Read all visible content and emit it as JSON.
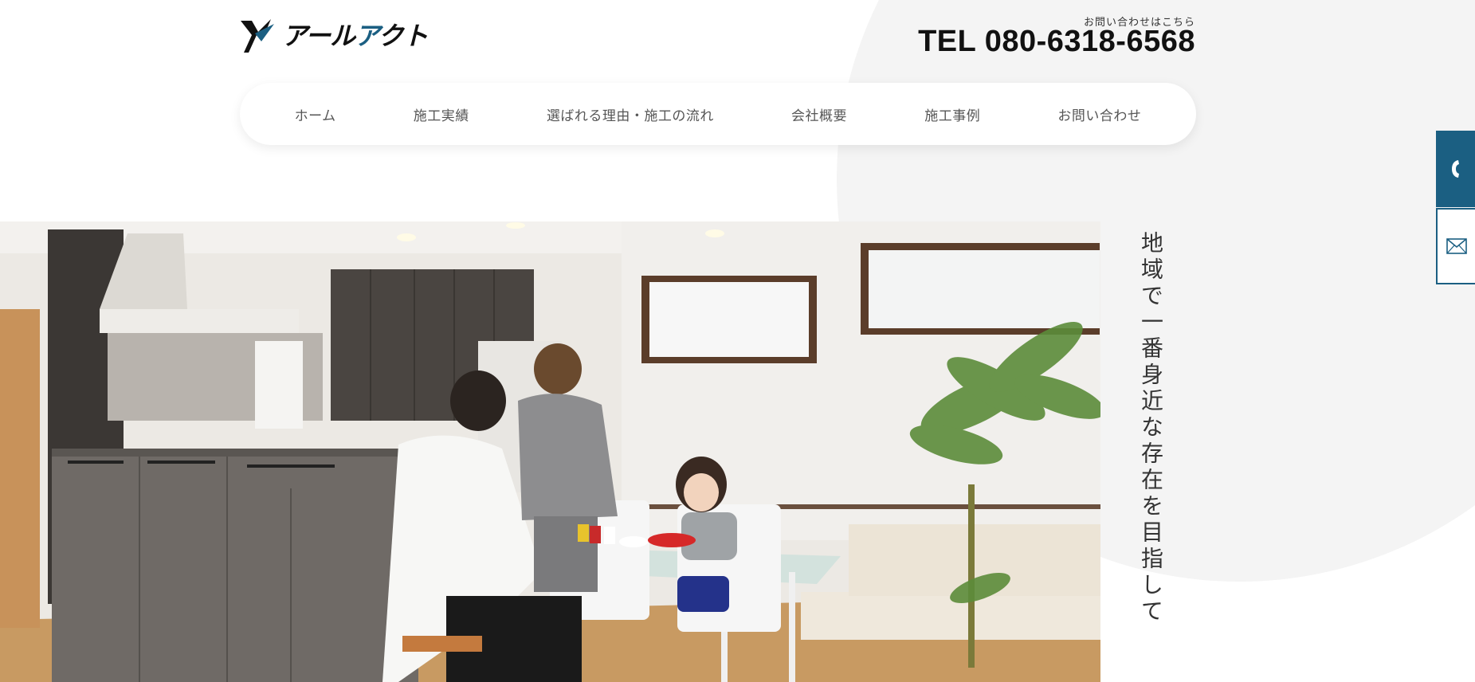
{
  "header": {
    "logo_text_black_1": "アール",
    "logo_text_accent": "ア",
    "logo_text_black_2": "クト",
    "tel_note": "お問い合わせはこちら",
    "tel": "TEL 080-6318-6568"
  },
  "nav": {
    "items": [
      {
        "label": "ホーム"
      },
      {
        "label": "施工実績"
      },
      {
        "label": "選ばれる理由・施工の流れ"
      },
      {
        "label": "会社概要"
      },
      {
        "label": "施工事例"
      },
      {
        "label": "お問い合わせ"
      }
    ]
  },
  "hero": {
    "catchcopy": "地域で一番身近な存在を目指して"
  },
  "side_buttons": {
    "phone_icon": "phone-icon",
    "mail_icon": "mail-icon"
  },
  "colors": {
    "accent": "#1b5f82",
    "background_circle": "#f4f4f4"
  }
}
